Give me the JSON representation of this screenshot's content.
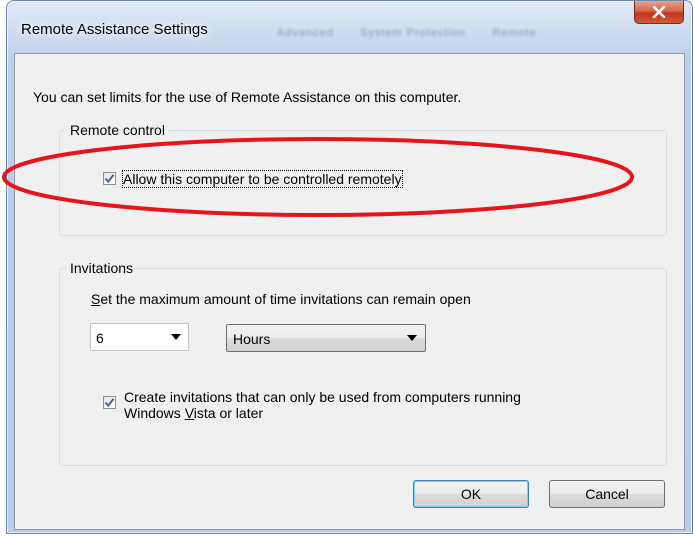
{
  "window": {
    "title": "Remote Assistance Settings",
    "ghost_tabs": [
      "Advanced",
      "System Protection",
      "Remote"
    ]
  },
  "dialog": {
    "intro_text": "You can set limits for the use of Remote Assistance on this computer.",
    "remote_control": {
      "legend": "Remote control",
      "allow_checkbox": {
        "label": "Allow this computer to be controlled remotely",
        "checked": true
      }
    },
    "invitations": {
      "legend": "Invitations",
      "max_time_label_prefix": "S",
      "max_time_label_rest": "et the maximum amount of time invitations can remain open",
      "amount": {
        "value": "6"
      },
      "unit": {
        "value": "Hours"
      },
      "vista_checkbox": {
        "label_line1": "Create invitations that can only be used from computers running",
        "label_line2_pre": "Windows ",
        "label_line2_accel": "V",
        "label_line2_post": "ista or later",
        "checked": true
      }
    },
    "buttons": {
      "ok": "OK",
      "cancel": "Cancel"
    }
  },
  "colors": {
    "annotation": "#e8141b",
    "checkmark": "#4a5d9a"
  }
}
